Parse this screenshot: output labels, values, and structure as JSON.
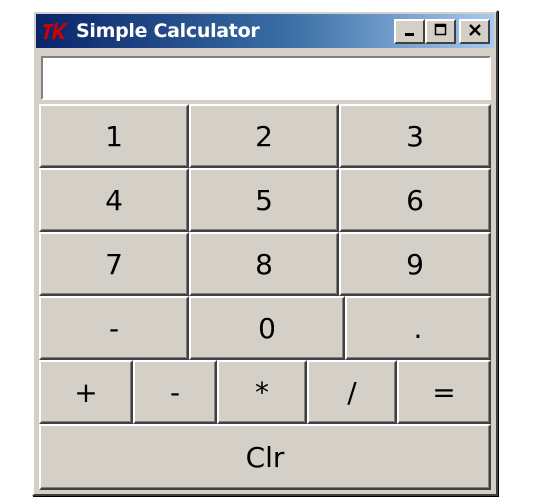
{
  "window": {
    "title": "Simple Calculator",
    "icon": "tk-feather-icon",
    "controls": {
      "minimize_icon": "minimize-icon",
      "maximize_icon": "maximize-icon",
      "close_icon": "close-icon"
    },
    "colors": {
      "titlebar_start": "#0a246a",
      "titlebar_end": "#a6caf0",
      "face": "#d4d0c8",
      "icon_red": "#d40000"
    }
  },
  "display": {
    "value": ""
  },
  "keys": {
    "k1": "1",
    "k2": "2",
    "k3": "3",
    "k4": "4",
    "k5": "5",
    "k6": "6",
    "k7": "7",
    "k8": "8",
    "k9": "9",
    "neg": "-",
    "k0": "0",
    "dot": ".",
    "plus": "+",
    "minus": "-",
    "mult": "*",
    "div": "/",
    "eq": "=",
    "clr": "Clr"
  }
}
